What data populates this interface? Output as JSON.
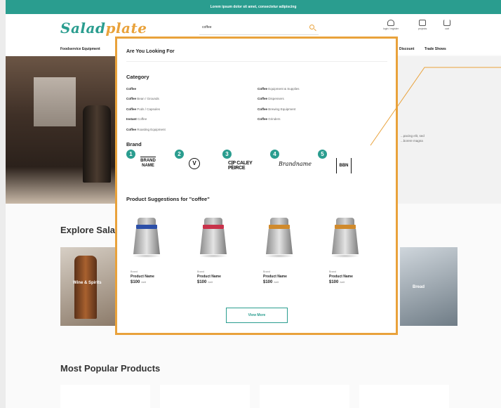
{
  "topbar": {
    "text": "Lorem ipsum dolor sit amet, consectetur adipiscing"
  },
  "header": {
    "logo_main": "Salad",
    "logo_accent": "plate",
    "search_value": "coffee",
    "icons": [
      {
        "name": "user-icon",
        "label": "login / register"
      },
      {
        "name": "folder-icon",
        "label": "projects"
      },
      {
        "name": "cart-icon",
        "label": "cart"
      }
    ]
  },
  "nav": {
    "left": "Foodservice Equipment",
    "right": [
      "Discount",
      "Trade Shows"
    ]
  },
  "hero": {
    "text_line1": "...pacing elit, sed",
    "text_line2": "...borere magna"
  },
  "explore": {
    "title": "Explore Sala",
    "card_left_label": "Wine & Spirits",
    "card_right_label": "Bread"
  },
  "popular": {
    "title": "Most Popular Products"
  },
  "dropdown": {
    "title": "Are You Looking For",
    "category_heading": "Category",
    "categories_left": [
      {
        "bold": "Coffee",
        "rest": ""
      },
      {
        "bold": "Coffee",
        "rest": " Bean / Grounds"
      },
      {
        "bold": "Coffee",
        "rest": " Pods / Capsules"
      },
      {
        "bold": "Instant ",
        "rest": "Coffee"
      },
      {
        "bold": "Coffee",
        "rest": " Roasting Equipment"
      }
    ],
    "categories_right": [
      {
        "bold": "Coffee",
        "rest": " Equipment & Supplies"
      },
      {
        "bold": "Coffee",
        "rest": " Dispensers"
      },
      {
        "bold": "Coffee",
        "rest": " Brewing Equipment"
      },
      {
        "bold": "Coffee",
        "rest": " Grinders"
      }
    ],
    "brand_heading": "Brand",
    "brands": [
      {
        "num": "1",
        "logo": "BRAND NAME"
      },
      {
        "num": "2",
        "logo": "V"
      },
      {
        "num": "3",
        "logo": "C|P CALEY PEIRCE"
      },
      {
        "num": "4",
        "logo": "Brandname"
      },
      {
        "num": "5",
        "logo": "BBN"
      }
    ],
    "suggestions_heading": "Product Suggestions for \"coffee\"",
    "products": [
      {
        "brand": "Brand",
        "name": "Product Name",
        "price": "$100",
        "unit": "/unit",
        "band": "#2c4fa8"
      },
      {
        "brand": "Brand",
        "name": "Product Name",
        "price": "$100",
        "unit": "/unit",
        "band": "#c8324a"
      },
      {
        "brand": "Brand",
        "name": "Product Name",
        "price": "$100",
        "unit": "/unit",
        "band": "#d08a2c"
      },
      {
        "brand": "Brand",
        "name": "Product Name",
        "price": "$100",
        "unit": "/unit",
        "band": "#d08a2c"
      }
    ],
    "view_more": "View More"
  },
  "colors": {
    "teal": "#2a9d8f",
    "orange": "#e9a23b"
  }
}
